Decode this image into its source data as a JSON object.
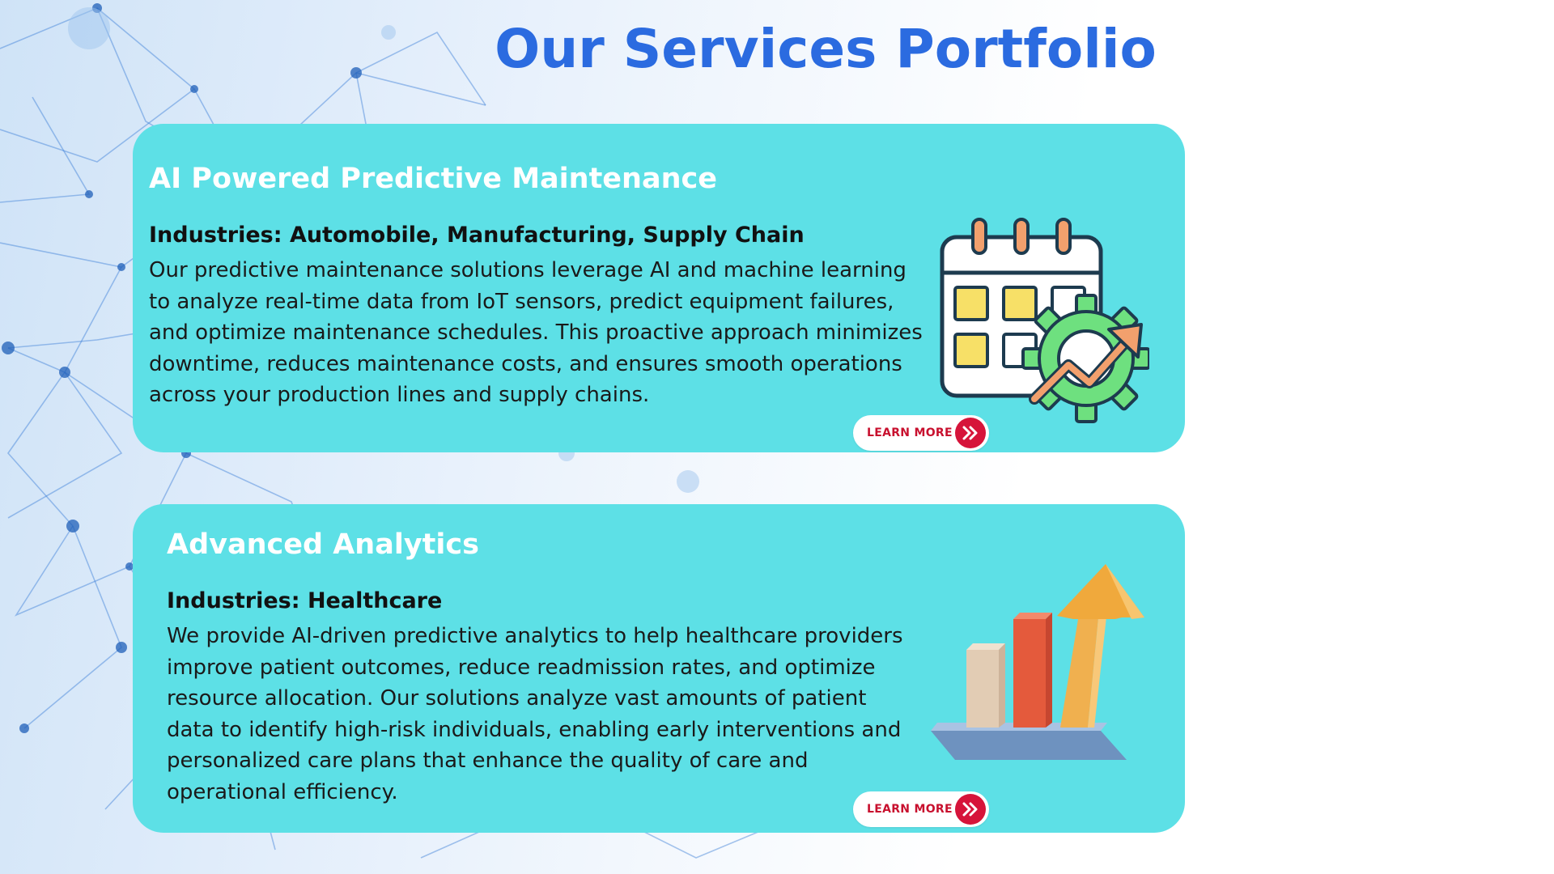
{
  "page": {
    "title": "Our Services Portfolio"
  },
  "colors": {
    "title": "#2b6be0",
    "card_bg": "#5de0e6",
    "card_title": "#ffffff",
    "button_accent": "#d6143a"
  },
  "services": [
    {
      "title": "AI Powered Predictive Maintenance",
      "industries": "Industries: Automobile, Manufacturing, Supply Chain",
      "description": "Our predictive maintenance solutions leverage AI and machine learning to analyze real-time data from IoT sensors, predict equipment failures, and optimize maintenance schedules. This proactive approach minimizes downtime, reduces maintenance costs, and ensures smooth operations across your production lines and supply chains.",
      "button_label": "LEARN MORE",
      "illustration_icon": "calendar-gear-icon"
    },
    {
      "title": "Advanced Analytics",
      "industries": "Industries: Healthcare",
      "description": "We provide AI-driven predictive analytics to help healthcare providers improve patient outcomes, reduce readmission rates, and optimize resource allocation. Our solutions analyze vast amounts of patient data to identify high-risk individuals, enabling early interventions and personalized care plans that enhance the quality of care and operational efficiency.",
      "button_label": "LEARN MORE",
      "illustration_icon": "growth-bar-chart-icon"
    }
  ]
}
